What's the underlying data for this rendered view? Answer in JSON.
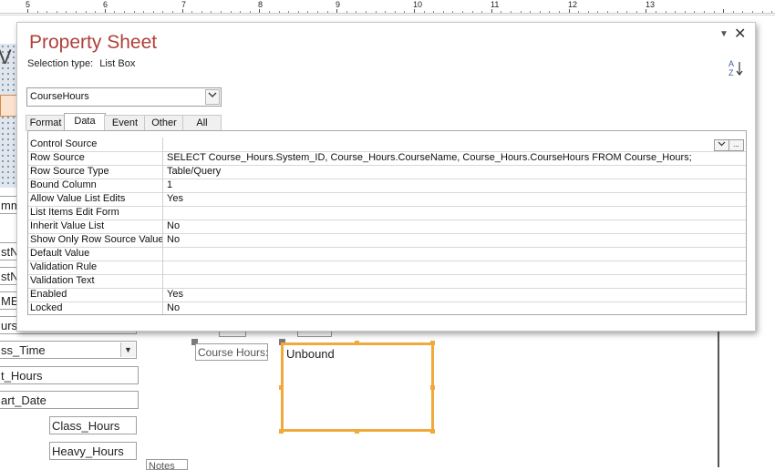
{
  "ruler": {
    "numbers": [
      {
        "label": "5"
      },
      {
        "label": "6"
      },
      {
        "label": "7"
      },
      {
        "label": "8"
      },
      {
        "label": "9"
      },
      {
        "label": "10"
      },
      {
        "label": "11"
      },
      {
        "label": "12"
      },
      {
        "label": "13"
      }
    ]
  },
  "background": {
    "fields": [
      {
        "text": "mm"
      },
      {
        "text": "stN"
      },
      {
        "text": "stN"
      },
      {
        "text": "ME"
      },
      {
        "text": "urs"
      },
      {
        "text": "ss_Time"
      },
      {
        "text": "t_Hours"
      },
      {
        "text": "art_Date"
      },
      {
        "text": "Class_Hours"
      },
      {
        "text": "Heavy_Hours"
      }
    ],
    "course_label": "Course Hours:",
    "listbox_value": "Unbound",
    "notes_label": "Notes"
  },
  "property_sheet": {
    "title": "Property Sheet",
    "selection_type_label": "Selection type:",
    "selection_type_value": "List Box",
    "object_selected": "CourseHours",
    "sort_icon_text": "A Z",
    "tabs": [
      {
        "label": "Format",
        "active": false
      },
      {
        "label": "Data",
        "active": true
      },
      {
        "label": "Event",
        "active": false
      },
      {
        "label": "Other",
        "active": false
      },
      {
        "label": "All",
        "active": false
      }
    ],
    "properties": [
      {
        "name": "Control Source",
        "value": ""
      },
      {
        "name": "Row Source",
        "value": "SELECT Course_Hours.System_ID, Course_Hours.CourseName, Course_Hours.CourseHours FROM Course_Hours;"
      },
      {
        "name": "Row Source Type",
        "value": "Table/Query"
      },
      {
        "name": "Bound Column",
        "value": "1"
      },
      {
        "name": "Allow Value List Edits",
        "value": "Yes"
      },
      {
        "name": "List Items Edit Form",
        "value": ""
      },
      {
        "name": "Inherit Value List",
        "value": "No"
      },
      {
        "name": "Show Only Row Source Values",
        "value": "No"
      },
      {
        "name": "Default Value",
        "value": ""
      },
      {
        "name": "Validation Rule",
        "value": ""
      },
      {
        "name": "Validation Text",
        "value": ""
      },
      {
        "name": "Enabled",
        "value": "Yes"
      },
      {
        "name": "Locked",
        "value": "No"
      }
    ],
    "builder_button_label": "..."
  },
  "colors": {
    "title": "#b0403a",
    "listbox_selection": "#f2a93b"
  }
}
